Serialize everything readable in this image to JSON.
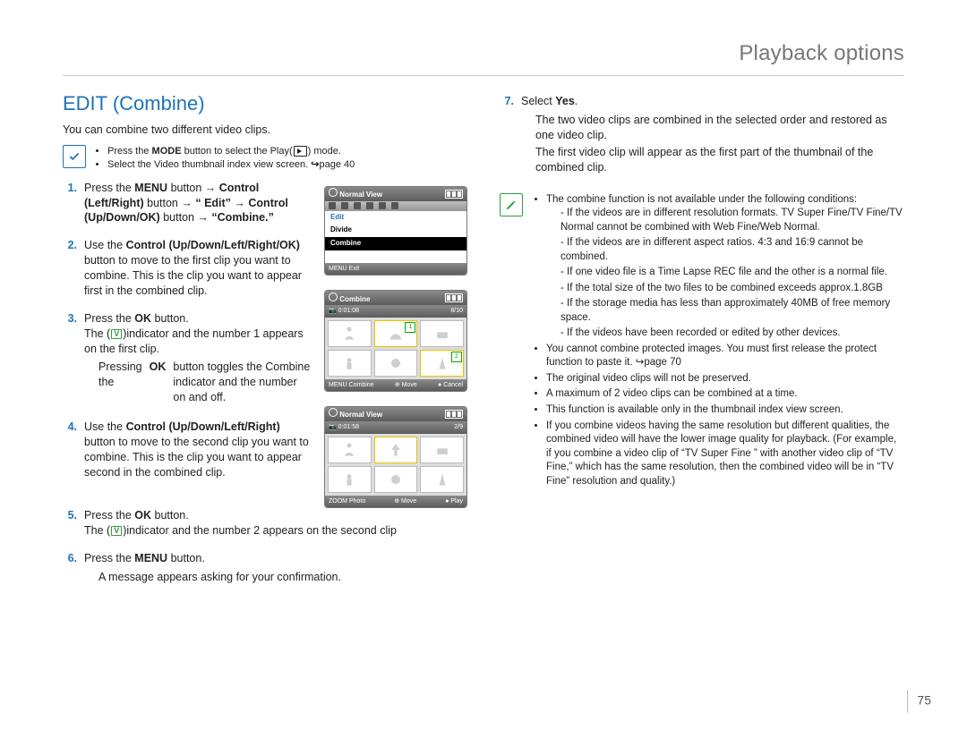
{
  "header": {
    "title": "Playback options"
  },
  "page_number": "75",
  "section_title": "EDIT (Combine)",
  "intro": "You can combine two different video clips.",
  "top_note": {
    "items": [
      "Press the MODE button to select the Play( ▶ ) mode.",
      "Select the Video thumbnail index view screen. ↪page 40"
    ]
  },
  "steps": [
    {
      "num": "1.",
      "html": "Press the <b>MENU</b> button → <b>Control (Left/Right)</b> button → <b>“ Edit”</b> → <b>Control (Up/Down/OK)</b> button → <b>“Combine.”</b>"
    },
    {
      "num": "2.",
      "html": "Use the <b>Control (Up/Down/Left/Right/OK)</b> button to move to the first clip you want to combine. This is the clip you want to appear first in the combined clip."
    },
    {
      "num": "3.",
      "html": "Press the <b>OK</b> button.<br>The (<span class='glyph-v'>V</span>)indicator and the number 1 appears on the first clip.",
      "sub": [
        "Pressing the <b>OK</b> button toggles the Combine indicator and the number on and off."
      ]
    },
    {
      "num": "4.",
      "html": "Use the <b>Control (Up/Down/Left/Right)</b> button to move to the second clip you want to combine. This is the clip you want to appear second in the combined clip."
    },
    {
      "num": "5.",
      "html": "Press the <b>OK</b> button.<br>The (<span class='glyph-v'>V</span>)indicator and the number 2 appears on the second clip"
    },
    {
      "num": "6.",
      "html": "Press the <b>MENU</b> button.",
      "sub": [
        "A message appears asking for your confirmation."
      ]
    },
    {
      "num": "7.",
      "html": "Select <b>Yes</b>.",
      "sub": [
        "The two video clips are combined in the selected order and restored as one video clip.",
        "The first video clip will appear as the first part of the thumbnail of the combined clip."
      ]
    }
  ],
  "right_note": {
    "lead": "The combine function is not available under the following conditions:",
    "dashes": [
      "If the videos are in different resolution formats. TV Super Fine/TV Fine/TV Normal cannot be combined with Web Fine/Web Normal.",
      "If the videos are in different aspect ratios. 4:3 and 16:9 cannot be combined.",
      "If one video file is a Time Lapse REC file and the other is a normal file.",
      "If the total size of the two files to be combined exceeds approx.1.8GB",
      "If the storage media has less than approximately 40MB of free memory space.",
      "If the videos have been recorded or edited by other devices."
    ],
    "bullets": [
      "You cannot combine protected images. You must first release the protect function to paste it. ↪page 70",
      "The original video clips will not be preserved.",
      "A maximum of 2 video clips can be combined at a time.",
      "This function is available only in the thumbnail index view screen.",
      "If you combine videos having the same resolution but different qualities, the combined video will have the lower image quality for playback. (For example, if you combine a video clip of “TV Super Fine ” with another video clip of “TV Fine,” which has the same resolution, then the combined video will be in “TV Fine” resolution and quality.)"
    ]
  },
  "shots": {
    "s1": {
      "title": "Normal View",
      "edit_label": "Edit",
      "row1": "Divide",
      "row2": "Combine",
      "foot_left": "MENU Exit"
    },
    "s2": {
      "title": "Combine",
      "info_left": "📷 0:01:08",
      "info_right": "8/10",
      "foot_left": "MENU Combine",
      "foot_mid": "⊕ Move",
      "foot_right": "● Cancel",
      "mark1": "1",
      "mark2": "2"
    },
    "s3": {
      "title": "Normal View",
      "info_left": "📷 0:01:58",
      "info_right": "2/9",
      "foot_left": "ZOOM Photo",
      "foot_mid": "⊕ Move",
      "foot_right": "● Play"
    }
  }
}
